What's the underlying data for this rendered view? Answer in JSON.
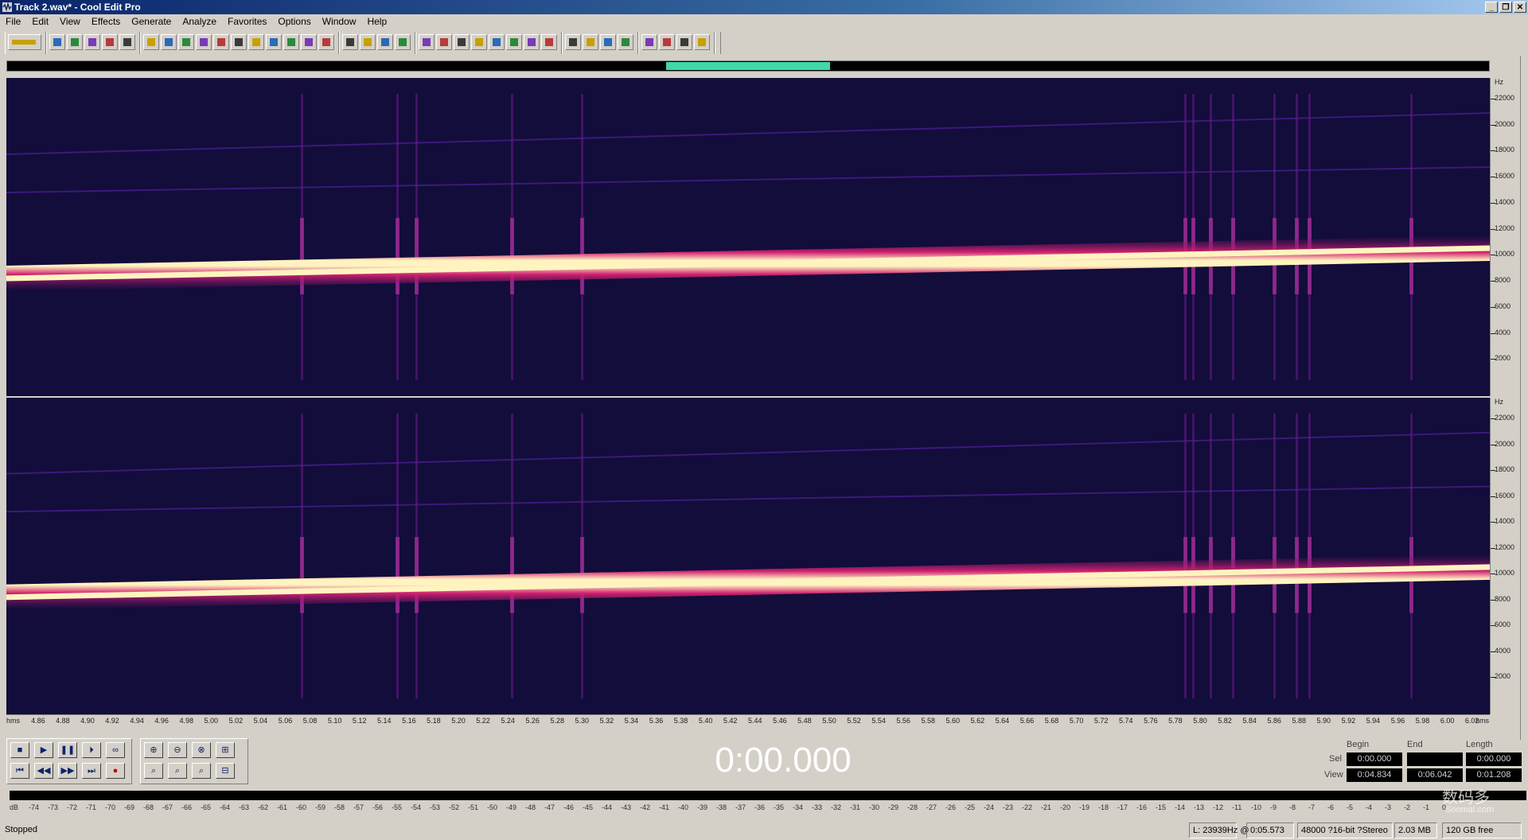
{
  "window": {
    "title": "Track 2.wav* - Cool Edit Pro"
  },
  "menu": [
    "File",
    "Edit",
    "View",
    "Effects",
    "Generate",
    "Analyze",
    "Favorites",
    "Options",
    "Window",
    "Help"
  ],
  "toolbar": {
    "buttons": [
      "waveform-view",
      "new",
      "open",
      "save",
      "save-as",
      "close",
      "undo",
      "redo",
      "cut-tool",
      "copy",
      "paste",
      "trim",
      "split",
      "insert",
      "mix-paste",
      "silence",
      "select-all",
      "spectral-view",
      "spectral-pan",
      "spectral-phase",
      "envelope-view",
      "edit-view",
      "multitrack-view",
      "play-cursor",
      "zoom-selection",
      "metronome",
      "cd-view",
      "mixer",
      "settings",
      "help",
      "fx-1",
      "fx-2",
      "fx-3",
      "fx-4",
      "tool-a",
      "tool-b",
      "tool-c"
    ]
  },
  "colors": {
    "spectrogram_bg": "#120d3a",
    "tone": "#fff4c0",
    "overview_sel": "#40d8a8"
  },
  "freq_labels": [
    "22000",
    "20000",
    "18000",
    "16000",
    "14000",
    "12000",
    "10000",
    "8000",
    "6000",
    "4000",
    "2000"
  ],
  "freq_unit": "Hz",
  "time_labels": [
    "hms",
    "4.86",
    "4.88",
    "4.90",
    "4.92",
    "4.94",
    "4.96",
    "4.98",
    "5.00",
    "5.02",
    "5.04",
    "5.06",
    "5.08",
    "5.10",
    "5.12",
    "5.14",
    "5.16",
    "5.18",
    "5.20",
    "5.22",
    "5.24",
    "5.26",
    "5.28",
    "5.30",
    "5.32",
    "5.34",
    "5.36",
    "5.38",
    "5.40",
    "5.42",
    "5.44",
    "5.46",
    "5.48",
    "5.50",
    "5.52",
    "5.54",
    "5.56",
    "5.58",
    "5.60",
    "5.62",
    "5.64",
    "5.66",
    "5.68",
    "5.70",
    "5.72",
    "5.74",
    "5.76",
    "5.78",
    "5.80",
    "5.82",
    "5.84",
    "5.86",
    "5.88",
    "5.90",
    "5.92",
    "5.94",
    "5.96",
    "5.98",
    "6.00",
    "6.02",
    "hms"
  ],
  "transport": {
    "time": "0:00.000",
    "buttons_row1": [
      "stop",
      "play",
      "pause",
      "play-to-end",
      "loop"
    ],
    "buttons_row2": [
      "go-start",
      "rewind",
      "fast-forward",
      "go-end",
      "record"
    ],
    "zoom_row1": [
      "zoom-in-full",
      "zoom-out",
      "zoom-out-full",
      "zoom-in-vertical"
    ],
    "zoom_row2": [
      "zoom-selection",
      "zoom-left",
      "zoom-right",
      "zoom-out-vertical"
    ]
  },
  "selection": {
    "headers": [
      "Begin",
      "End",
      "Length"
    ],
    "sel_label": "Sel",
    "view_label": "View",
    "sel": [
      "0:00.000",
      "",
      "0:00.000"
    ],
    "view": [
      "0:04.834",
      "0:06.042",
      "0:01.208"
    ]
  },
  "level_labels": [
    "dB",
    "-74",
    "-73",
    "-72",
    "-71",
    "-70",
    "-69",
    "-68",
    "-67",
    "-66",
    "-65",
    "-64",
    "-63",
    "-62",
    "-61",
    "-60",
    "-59",
    "-58",
    "-57",
    "-56",
    "-55",
    "-54",
    "-53",
    "-52",
    "-51",
    "-50",
    "-49",
    "-48",
    "-47",
    "-46",
    "-45",
    "-44",
    "-43",
    "-42",
    "-41",
    "-40",
    "-39",
    "-38",
    "-37",
    "-36",
    "-35",
    "-34",
    "-33",
    "-32",
    "-31",
    "-30",
    "-29",
    "-28",
    "-27",
    "-26",
    "-25",
    "-24",
    "-23",
    "-22",
    "-21",
    "-20",
    "-19",
    "-18",
    "-17",
    "-16",
    "-15",
    "-14",
    "-13",
    "-12",
    "-11",
    "-10",
    "-9",
    "-8",
    "-7",
    "-6",
    "-5",
    "-4",
    "-3",
    "-2",
    "-1",
    "0"
  ],
  "status": {
    "state": "Stopped",
    "cursor": "L: 23939Hz @",
    "cursor_time": "0:05.573",
    "format": "48000 ?16-bit ?Stereo",
    "size": "2.03 MB",
    "free": "120 GB free"
  },
  "watermark": {
    "main": "数码多",
    "sub": "Soomal.com"
  }
}
